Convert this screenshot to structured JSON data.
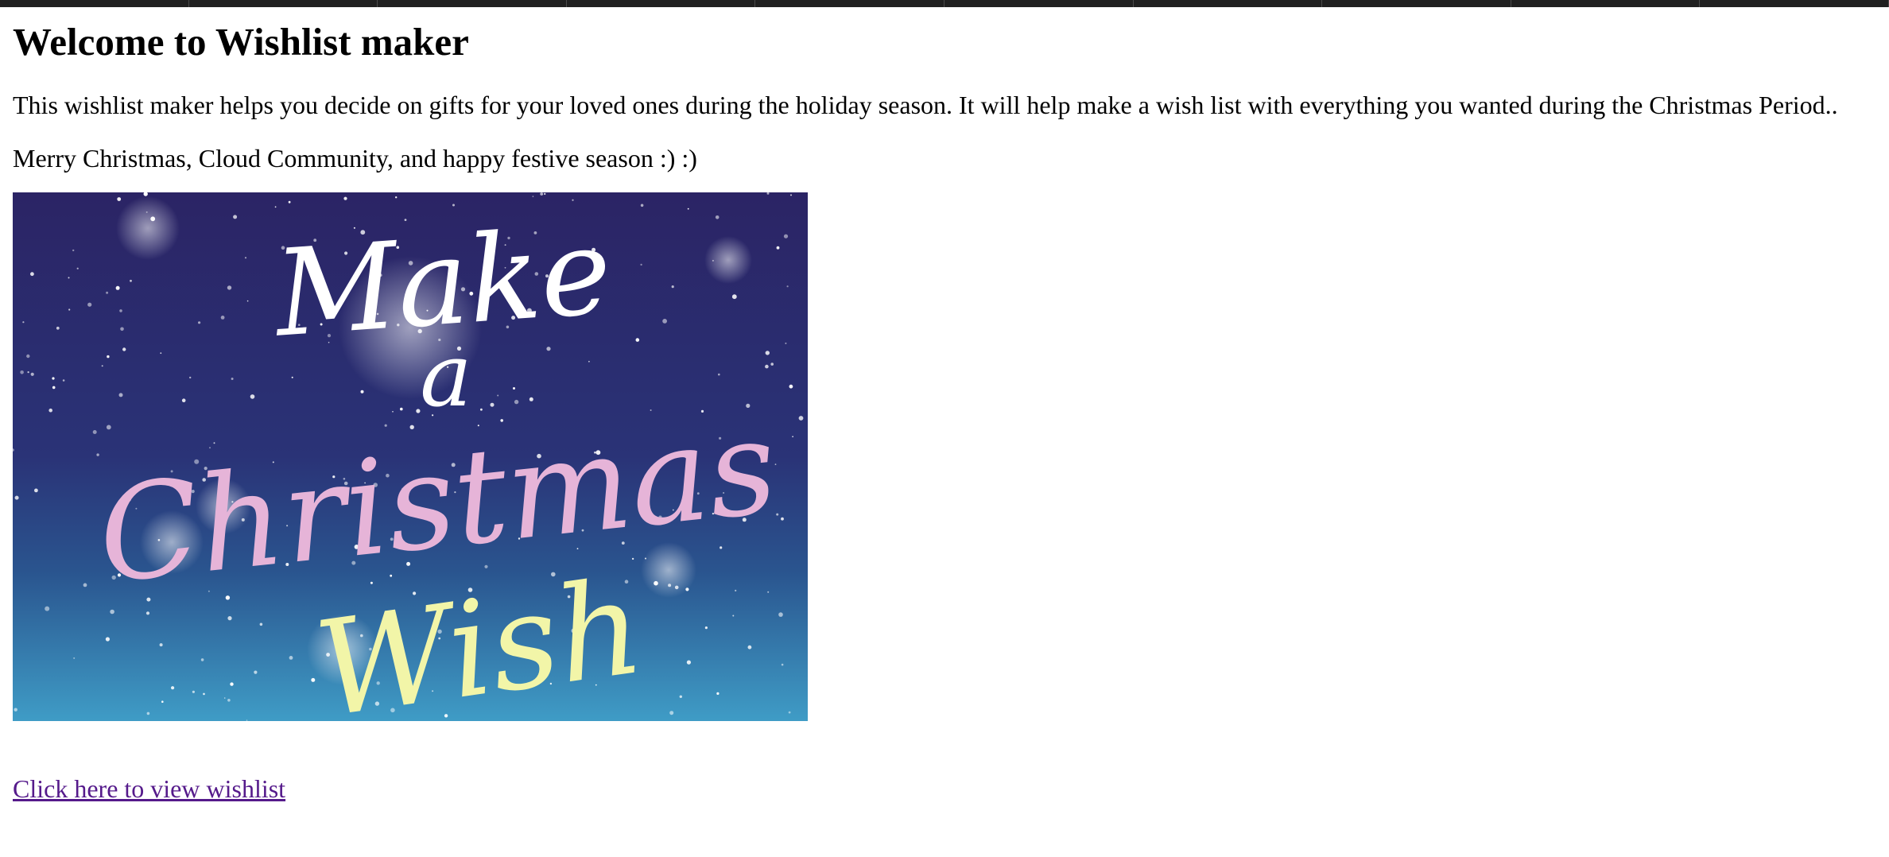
{
  "page": {
    "title": "Welcome to Wishlist maker",
    "intro": "This wishlist maker helps you decide on gifts for your loved ones during the holiday season. It will help make a wish list with everything you wanted during the Christmas Period..",
    "greeting": "Merry Christmas, Cloud Community, and happy festive season :) :)",
    "link_text": "Click here to view wishlist"
  },
  "banner": {
    "lines": [
      "Make",
      "a",
      "Christmas",
      "Wish"
    ],
    "colors": {
      "sky_top": "#2b2465",
      "sky_mid": "#2a3f86",
      "sky_bottom": "#3d9ac4",
      "make_a": "#ffffff",
      "christmas": "#e6b4d8",
      "wish": "#f2f5a8"
    }
  },
  "colors": {
    "link": "#551a8b",
    "top_bar": "#202020"
  }
}
